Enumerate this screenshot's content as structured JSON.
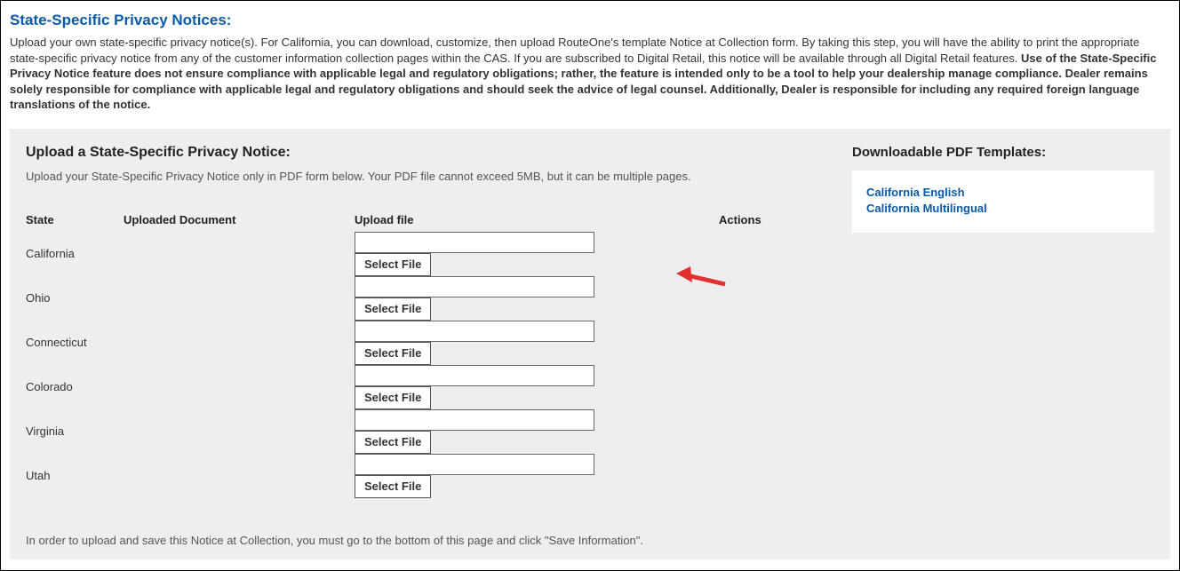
{
  "header": {
    "title": "State-Specific Privacy Notices:",
    "intro_plain_1": "Upload your own state-specific privacy notice(s). For California, you can download, customize, then upload RouteOne's template Notice at Collection form. By taking this step, you will have the ability to print the appropriate state-specific privacy notice from any of the customer information collection pages within the CAS. If you are subscribed to Digital Retail, this notice will be available through all Digital Retail features. ",
    "intro_bold": "Use of the State-Specific Privacy Notice feature does not ensure compliance with applicable legal and regulatory obligations; rather, the feature is intended only to be a tool to help your dealership manage compliance. Dealer remains solely responsible for compliance with applicable legal and regulatory obligations and should seek the advice of legal counsel. Additionally, Dealer is responsible for including any required foreign language translations of the notice."
  },
  "upload": {
    "title": "Upload a State-Specific Privacy Notice:",
    "desc": "Upload your State-Specific Privacy Notice only in PDF form below. Your PDF file cannot exceed 5MB, but it can be multiple pages.",
    "columns": {
      "state": "State",
      "doc": "Uploaded Document",
      "file": "Upload file",
      "actions": "Actions"
    },
    "rows": [
      {
        "state": "California",
        "select_label": "Select File"
      },
      {
        "state": "Ohio",
        "select_label": "Select File"
      },
      {
        "state": "Connecticut",
        "select_label": "Select File"
      },
      {
        "state": "Colorado",
        "select_label": "Select File"
      },
      {
        "state": "Virginia",
        "select_label": "Select File"
      },
      {
        "state": "Utah",
        "select_label": "Select File"
      }
    ],
    "footnote": "In order to upload and save this Notice at Collection, you must go to the bottom of this page and click \"Save Information\"."
  },
  "downloads": {
    "title": "Downloadable PDF Templates:",
    "links": [
      "California English",
      "California Multilingual"
    ]
  }
}
